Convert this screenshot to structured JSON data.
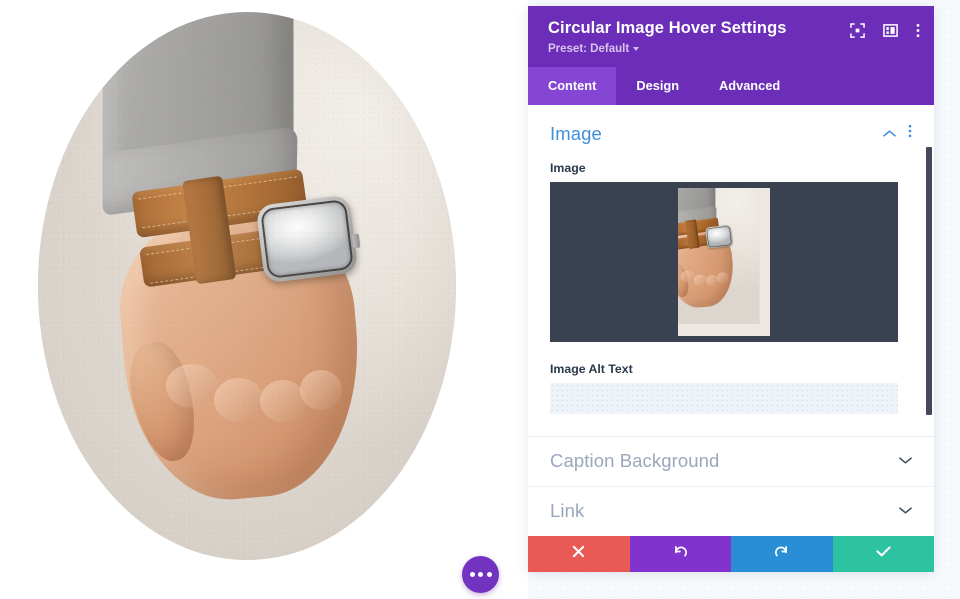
{
  "canvas": {
    "image_alt": "hand-with-smartwatch-photo",
    "shape": "oval",
    "fab": {
      "name": "more-options",
      "icon": "ellipsis-icon"
    }
  },
  "panel": {
    "title": "Circular Image Hover Settings",
    "preset_label": "Preset: Default",
    "header_icons": [
      {
        "name": "focus-icon"
      },
      {
        "name": "layout-icon"
      },
      {
        "name": "kebab-menu-icon"
      }
    ],
    "tabs": [
      {
        "label": "Content",
        "active": true
      },
      {
        "label": "Design",
        "active": false
      },
      {
        "label": "Advanced",
        "active": false
      }
    ],
    "sections": [
      {
        "title": "Image",
        "state": "expanded",
        "fields": [
          {
            "label": "Image",
            "type": "image-upload",
            "value": "hand-with-smartwatch-photo"
          },
          {
            "label": "Image Alt Text",
            "type": "text",
            "value": "",
            "placeholder": ""
          }
        ]
      },
      {
        "title": "Caption Background",
        "state": "collapsed"
      },
      {
        "title": "Link",
        "state": "collapsed"
      }
    ],
    "footer_actions": [
      {
        "name": "cancel",
        "icon": "close-x-icon",
        "color": "#ea5a55"
      },
      {
        "name": "undo",
        "icon": "undo-arrow-icon",
        "color": "#8232cd"
      },
      {
        "name": "redo",
        "icon": "redo-arrow-icon",
        "color": "#2a8ed6"
      },
      {
        "name": "save",
        "icon": "checkmark-icon",
        "color": "#2ec3a0"
      }
    ]
  },
  "colors": {
    "header_purple": "#6c2eb9",
    "tab_active_purple": "#8646d4",
    "section_title_blue": "#3f8fd8",
    "section_collapsed_grey": "#9aa7bb",
    "preview_dark": "#3a4150",
    "page_background": "#f7fafd"
  }
}
